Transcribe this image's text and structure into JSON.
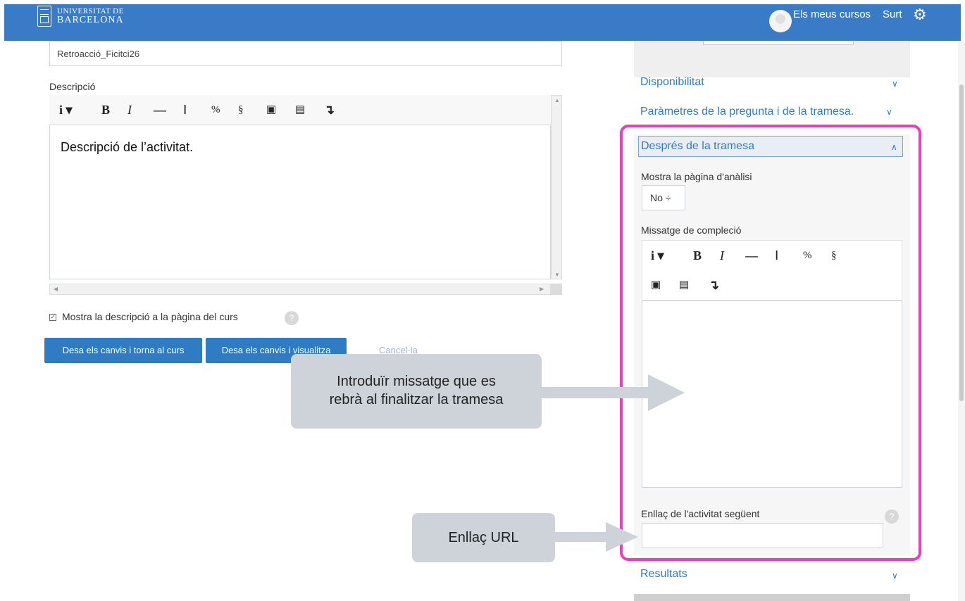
{
  "navbar": {
    "logo_line1": "UNIVERSITAT DE",
    "logo_line2": "BARCELONA",
    "my_courses": "Els meus cursos",
    "logout": "Surt",
    "gear_icon": "gear-icon"
  },
  "form": {
    "name_value": "Retroacció_Ficitci26",
    "description_label": "Descripció",
    "description_text": "Descripció de l’activitat.",
    "show_description_label": "Mostra la descripció a la pàgina del curs",
    "buttons": {
      "save_return": "Desa els canvis i torna al curs",
      "save_view": "Desa els canvis i visualitza",
      "cancel": "Cancel·la"
    }
  },
  "sidebar": {
    "availability": "Disponibilitat",
    "question_params": "Paràmetres de la pregunta i de la tramesa.",
    "after_submission": "Després de la tramesa",
    "analysis_label": "Mostra la pàgina d'anàlisi",
    "analysis_value": "No ÷",
    "completion_label": "Missatge de compleció",
    "next_activity_label": "Enllaç de l'activitat següent",
    "results": "Resultats"
  },
  "annotations": {
    "callout_message": [
      "Introduïr missatge que es",
      "rebrà al finalitzar la tramesa"
    ],
    "callout_url": "Enllaç URL",
    "highlight_color": "#e83ec0"
  },
  "colors": {
    "brand": "#3a7bc8",
    "button": "#2f7bc4"
  }
}
